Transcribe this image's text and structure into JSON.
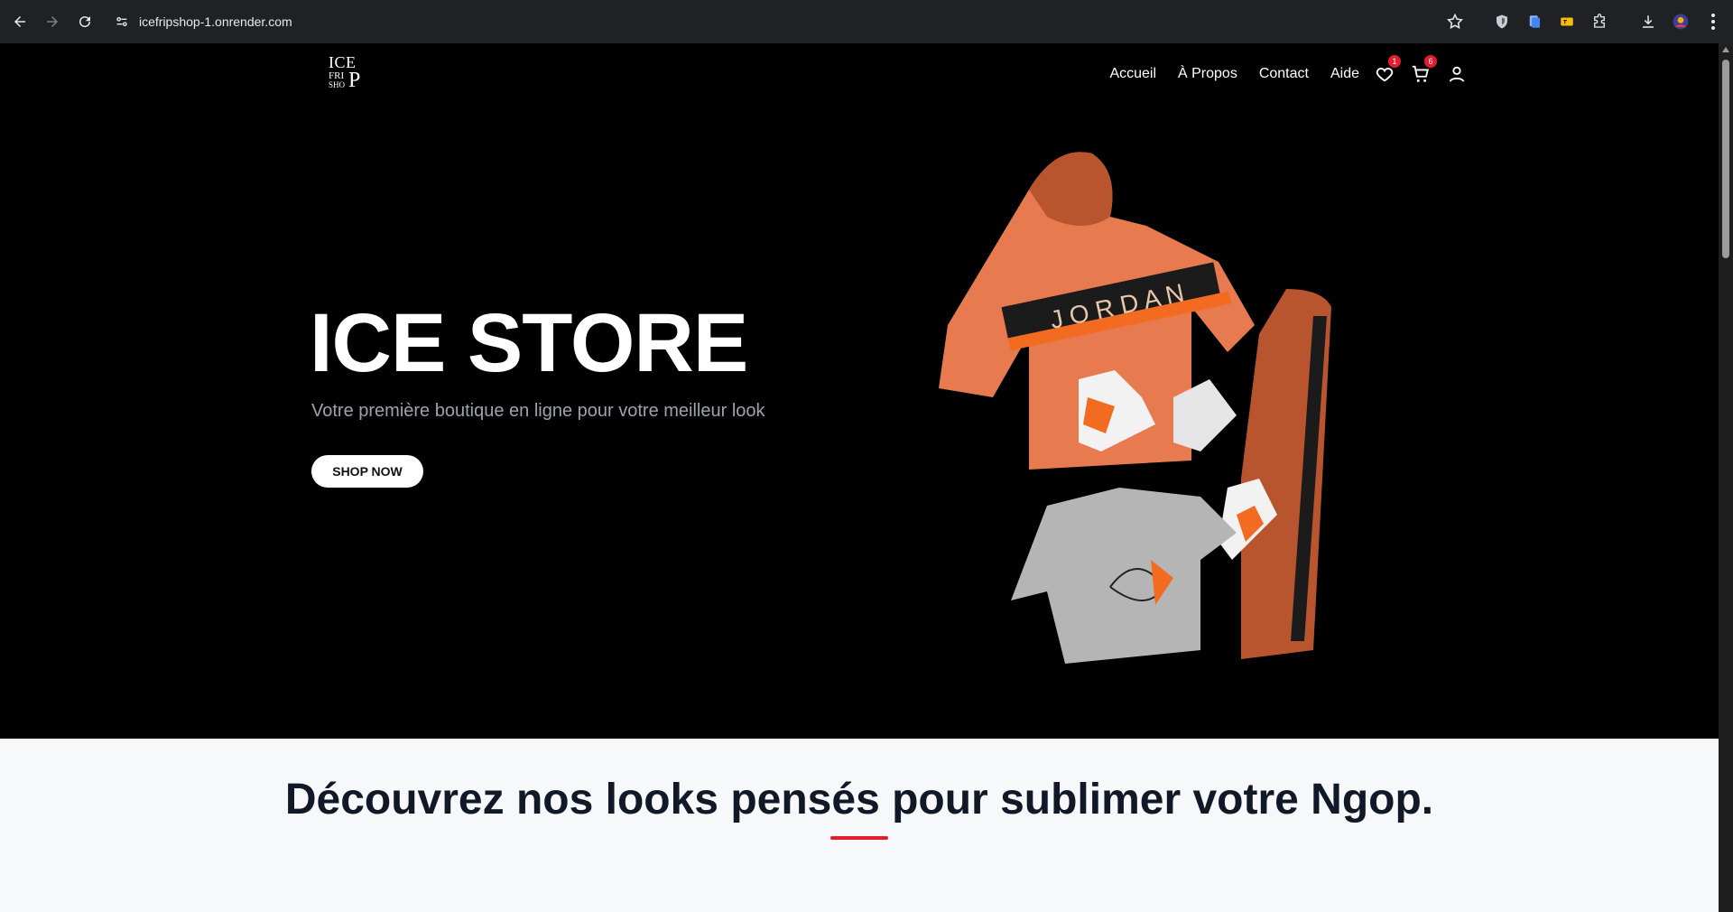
{
  "browser": {
    "url": "icefripshop-1.onrender.com",
    "icons": [
      "back-icon",
      "forward-icon",
      "reload-icon",
      "site-info-icon",
      "bookmark-star-icon",
      "extension-icons",
      "download-icon",
      "profile-icon",
      "menu-icon"
    ]
  },
  "header": {
    "logo": {
      "line1": "ICE",
      "line2": "FRI",
      "line3": "SHO",
      "p": "P"
    },
    "nav": [
      {
        "label": "Accueil"
      },
      {
        "label": "À Propos"
      },
      {
        "label": "Contact"
      },
      {
        "label": "Aide"
      }
    ],
    "wishlist_count": "1",
    "cart_count": "6"
  },
  "hero": {
    "title": "ICE STORE",
    "subtitle": "Votre première boutique en ligne pour votre meilleur look",
    "cta_label": "SHOP NOW",
    "image_text": "J O R D A N"
  },
  "section": {
    "title": "Découvrez nos looks pensés pour sublimer votre Ngop.",
    "accent_color": "#e11d2e"
  },
  "colors": {
    "background": "#000000",
    "hero_subtitle": "#9ca3af",
    "section_bg": "#f7f8fa",
    "badge": "#e11d2e"
  }
}
